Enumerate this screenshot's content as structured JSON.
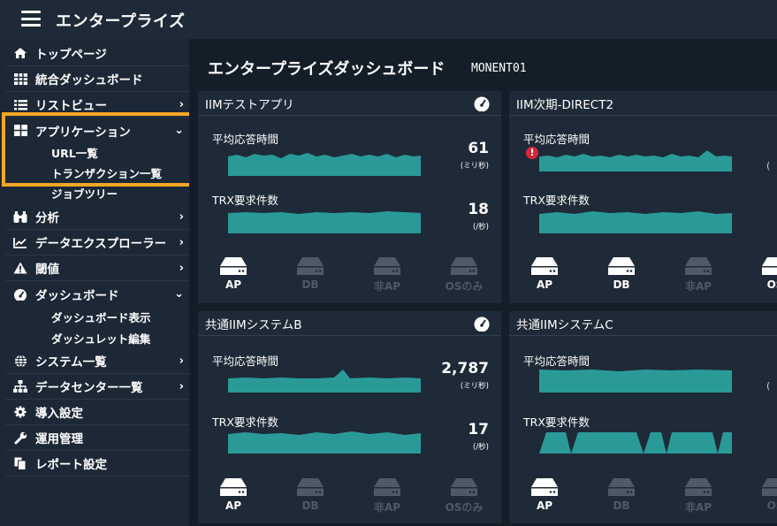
{
  "app": {
    "title": "エンタープライズ"
  },
  "page": {
    "title": "エンタープライズダッシュボード",
    "subtitle": "MONENT01"
  },
  "sidebar": {
    "items": [
      {
        "label": "トップページ",
        "icon": "home-icon"
      },
      {
        "label": "統合ダッシュボード",
        "icon": "grid-icon"
      },
      {
        "label": "リストビュー",
        "icon": "list-icon",
        "chevron": "›"
      },
      {
        "label": "アプリケーション",
        "icon": "app-grid-icon",
        "chevron": "⌄"
      },
      {
        "label": "分析",
        "icon": "binoculars-icon",
        "chevron": "›"
      },
      {
        "label": "データエクスプローラー",
        "icon": "line-chart-icon",
        "chevron": "›"
      },
      {
        "label": "閾値",
        "icon": "warning-icon",
        "chevron": "›"
      },
      {
        "label": "ダッシュボード",
        "icon": "dashboard-gauge-icon",
        "chevron": "⌄"
      },
      {
        "label": "システム一覧",
        "icon": "globe-icon",
        "chevron": "›"
      },
      {
        "label": "データセンター一覧",
        "icon": "sitemap-icon",
        "chevron": "›"
      },
      {
        "label": "導入設定",
        "icon": "cog-icon"
      },
      {
        "label": "運用管理",
        "icon": "wrench-icon"
      },
      {
        "label": "レポート設定",
        "icon": "copy-icon"
      }
    ],
    "app_sub": [
      "URL一覧",
      "トランザクション一覧",
      "ジョブツリー"
    ],
    "dash_sub": [
      "ダッシュボード表示",
      "ダッシュレット編集"
    ]
  },
  "labels": {
    "avg_response": "平均応答時間",
    "trx": "TRX要求件数",
    "unit_ms": "(ミリ秒)",
    "unit_per_sec": "(/秒)",
    "ap": "AP",
    "db": "DB",
    "non_ap": "非AP",
    "os_only": "OSのみ",
    "os_cut": "OS"
  },
  "cards": [
    {
      "title": "IIMテストアプリ",
      "avg": "61",
      "trx": "18"
    },
    {
      "title": "IIM次期-DIRECT2",
      "alert": "!",
      "unit_cut": "("
    },
    {
      "title": "共通IIMシステムB",
      "avg": "2,787",
      "trx": "17"
    },
    {
      "title": "共通IIMシステムC",
      "unit_cut": "("
    }
  ],
  "colors": {
    "accent": "#f7a623",
    "spark_fill": "#2a9a98",
    "alert": "#d9263a"
  }
}
